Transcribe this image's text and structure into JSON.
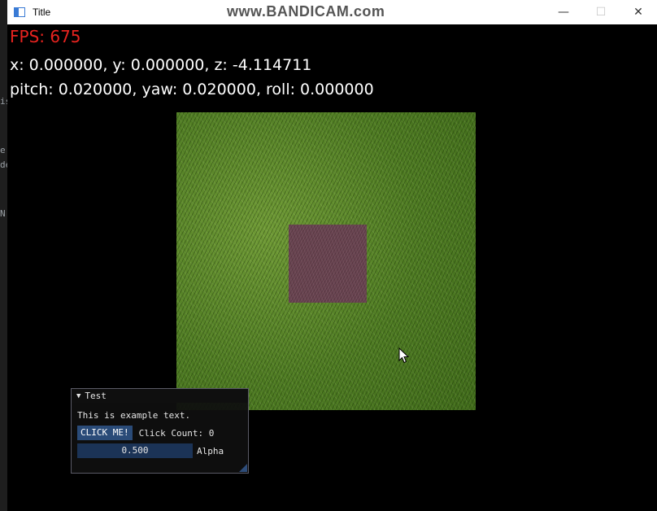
{
  "window": {
    "title": "Title",
    "watermark": "www.BANDICAM.com",
    "controls": {
      "minimize_icon": "minimize-icon",
      "maximize_icon": "maximize-icon",
      "close_icon": "close-icon"
    }
  },
  "overlay": {
    "fps": "FPS: 675",
    "position": "x: 0.000000, y: 0.000000, z: -4.114711",
    "rotation": "pitch: 0.020000, yaw: 0.020000, roll: 0.000000",
    "fps_color": "#e8231f"
  },
  "scene": {
    "ground_texture": "grass",
    "cube_color": "#6b4552"
  },
  "imgui": {
    "title": "Test",
    "text": "This is example text.",
    "button_label": "CLICK ME!",
    "click_count": "Click Count: 0",
    "slider_value": "0.500",
    "slider_label": "Alpha"
  }
}
